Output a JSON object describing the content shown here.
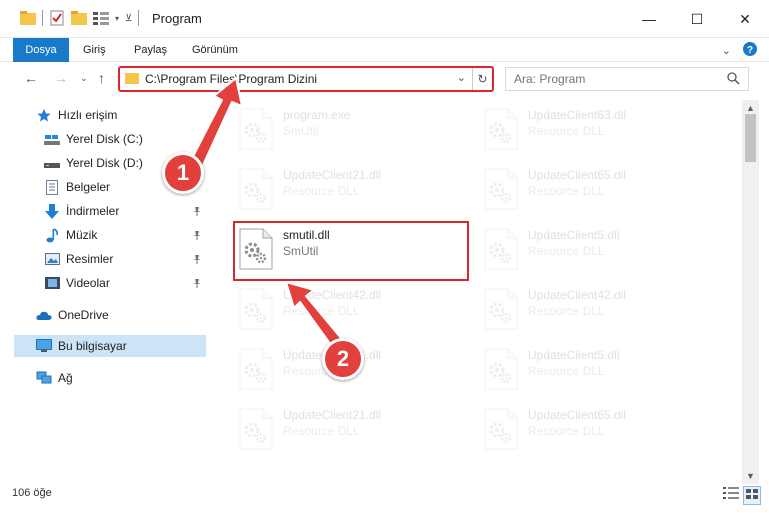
{
  "window": {
    "title": "Program",
    "minimize": "—",
    "maximize": "☐",
    "close": "✕"
  },
  "ribbon": {
    "tabs": [
      "Dosya",
      "Giriş",
      "Paylaş",
      "Görünüm"
    ]
  },
  "address": {
    "path": "C:\\Program Files\\Program Dizini",
    "search_placeholder": "Ara: Program"
  },
  "sidebar": {
    "items": [
      {
        "label": "Hızlı erişim",
        "icon": "star-icon",
        "pinned": false
      },
      {
        "label": "Yerel Disk (C:)",
        "icon": "drive-icon",
        "pinned": false
      },
      {
        "label": "Yerel Disk (D:)",
        "icon": "drive-icon",
        "pinned": false
      },
      {
        "label": "Belgeler",
        "icon": "documents-icon",
        "pinned": false
      },
      {
        "label": "İndirmeler",
        "icon": "download-icon",
        "pinned": true
      },
      {
        "label": "Müzik",
        "icon": "music-icon",
        "pinned": true
      },
      {
        "label": "Resimler",
        "icon": "pictures-icon",
        "pinned": true
      },
      {
        "label": "Videolar",
        "icon": "videos-icon",
        "pinned": true
      },
      {
        "label": "OneDrive",
        "icon": "cloud-icon",
        "pinned": false
      },
      {
        "label": "Bu bilgisayar",
        "icon": "computer-icon",
        "pinned": false,
        "selected": true
      },
      {
        "label": "Ağ",
        "icon": "network-icon",
        "pinned": false
      }
    ]
  },
  "files": [
    {
      "name": "program.exe",
      "desc": "SmUtil",
      "faded": true,
      "col": 0,
      "row": 0
    },
    {
      "name": "UpdateClient63.dll",
      "desc": "Resource DLL",
      "faded": true,
      "col": 1,
      "row": 0
    },
    {
      "name": "UpdateClient21.dll",
      "desc": "Resource DLL",
      "faded": true,
      "col": 0,
      "row": 1
    },
    {
      "name": "UpdateClient65.dll",
      "desc": "Resource DLL",
      "faded": true,
      "col": 1,
      "row": 1
    },
    {
      "name": "smutil.dll",
      "desc": "SmUtil",
      "faded": false,
      "col": 0,
      "row": 2
    },
    {
      "name": "UpdateClient5.dll",
      "desc": "Resource DLL",
      "faded": true,
      "col": 1,
      "row": 2
    },
    {
      "name": "UpdateClient42.dll",
      "desc": "Resource DLL",
      "faded": true,
      "col": 0,
      "row": 3
    },
    {
      "name": "UpdateClient42.dll",
      "desc": "Resource DLL",
      "faded": true,
      "col": 1,
      "row": 3
    },
    {
      "name": "UpdateClient21.dll",
      "desc": "Resource DLL",
      "faded": true,
      "col": 0,
      "row": 4
    },
    {
      "name": "UpdateClient5.dll",
      "desc": "Resource DLL",
      "faded": true,
      "col": 1,
      "row": 4
    },
    {
      "name": "UpdateClient21.dll",
      "desc": "Resource DLL",
      "faded": true,
      "col": 0,
      "row": 5
    },
    {
      "name": "UpdateClient65.dll",
      "desc": "Resource DLL",
      "faded": true,
      "col": 1,
      "row": 5
    }
  ],
  "status": {
    "item_count": "106 öğe"
  },
  "callouts": [
    "1",
    "2"
  ],
  "colors": {
    "accent": "#1979ca",
    "highlight_red": "#d9262c",
    "callout_red": "#e2403c",
    "selected_bg": "#cce4f7"
  }
}
